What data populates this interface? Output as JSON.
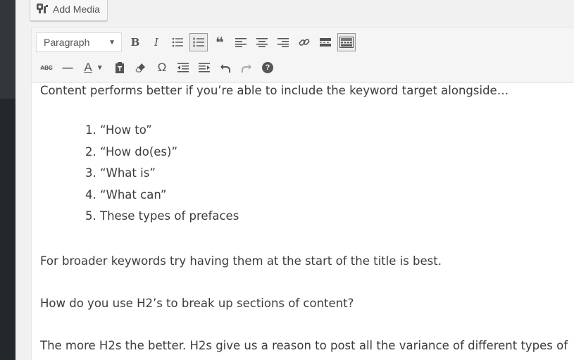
{
  "media": {
    "add_media_label": "Add Media"
  },
  "toolbar": {
    "format_select_value": "Paragraph",
    "row1": [
      "bold-button",
      "italic-button",
      "bulleted-list-button",
      "numbered-list-button",
      "blockquote-button",
      "align-left-button",
      "align-center-button",
      "align-right-button",
      "insert-link-button",
      "read-more-button",
      "toolbar-toggle-button"
    ],
    "row2": [
      "strikethrough-button",
      "horizontal-line-button",
      "text-color-button",
      "paste-as-text-button",
      "clear-formatting-button",
      "special-character-button",
      "decrease-indent-button",
      "increase-indent-button",
      "undo-button",
      "redo-button",
      "help-button"
    ],
    "bold_label": "B",
    "italic_label": "I",
    "text_color_label": "A",
    "special_char_label": "Ω",
    "help_label": "?",
    "strike_label": "ABC",
    "hr_label": "—",
    "quote_label": "❝"
  },
  "content": {
    "intro": "Content performs better if you’re able to include the keyword target alongside…",
    "list_items": [
      "1. “How to”",
      "2. “How do(es)”",
      "3. “What is”",
      "4. “What can”",
      "5. These types of prefaces"
    ],
    "para_broader": "For broader keywords try having them at the start of the title is best.",
    "para_h2_question": "How do you use H2’s to break up sections of content?",
    "para_h2_answer": "The more H2s the better. H2s give us a reason to post all the variance of different types of"
  }
}
